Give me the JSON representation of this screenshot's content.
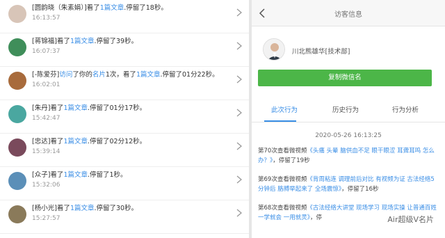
{
  "visitors": [
    {
      "name": "[圆韵晓（朱素娟）]",
      "action": "看了",
      "count": "1篇文章",
      "duration": ".停留了18秒。",
      "time": "16:13:57",
      "avatar_color": "#d8c5b8"
    },
    {
      "name": "[蒋锦福]",
      "action": "看了",
      "count": "1篇文章",
      "duration": ".停留了39秒。",
      "time": "16:07:37",
      "avatar_color": "#3f8e5a"
    },
    {
      "name": "[-陈爱芬]",
      "action": "访问",
      "extra1": "了你的",
      "card": "名片",
      "extra2": "1次，看了",
      "count": "1篇文章",
      "duration": ".停留了01分22秒。",
      "time": "16:02:01",
      "avatar_color": "#a86b3c"
    },
    {
      "name": "[朱丹]",
      "action": "看了",
      "count": "1篇文章",
      "duration": ".停留了01分17秒。",
      "time": "15:42:47",
      "avatar_color": "#4aa7a0"
    },
    {
      "name": "[忠达]",
      "action": "看了",
      "count": "1篇文章",
      "duration": ".停留了02分12秒。",
      "time": "15:39:14",
      "avatar_color": "#7a4a5c"
    },
    {
      "name": "[众子]",
      "action": "看了",
      "count": "1篇文章",
      "duration": ".停留了1秒。",
      "time": "15:32:06",
      "avatar_color": "#5b8fb8"
    },
    {
      "name": "[杨小光]",
      "action": "看了",
      "count": "1篇文章",
      "duration": ".停留了30秒。",
      "time": "15:27:57",
      "avatar_color": "#8a7a5a"
    }
  ],
  "detail": {
    "title": "访客信息",
    "profile_name": "川北熊雄华[技术部]",
    "wechat_button": "复制微信名",
    "tabs": [
      "此次行为",
      "历史行为",
      "行为分析"
    ],
    "date": "2020-05-26 16:13:25",
    "records": [
      {
        "prefix": "第70次查看微视频",
        "title": "《头痛 头晕 脑供血不足 眼干眼涩 耳聋耳鸣 怎么办？》",
        "suffix": "，停留了19秒"
      },
      {
        "prefix": "第69次查看微视频",
        "title": "《背周粘连 调理前后对比 有视频为证 古法经络5分钟后 胳膊举起来了 全场震惊》",
        "suffix": "，停留了16秒"
      },
      {
        "prefix": "第68次查看微视频",
        "title": "《古法经络大讲堂 现场学习 现场实操 让普通百姓一学就会 一用就灵》",
        "suffix": "，停"
      }
    ],
    "watermark": "Air超级V名片"
  },
  "colors": {
    "accent": "#3a8ee6",
    "green": "#4cb648"
  }
}
